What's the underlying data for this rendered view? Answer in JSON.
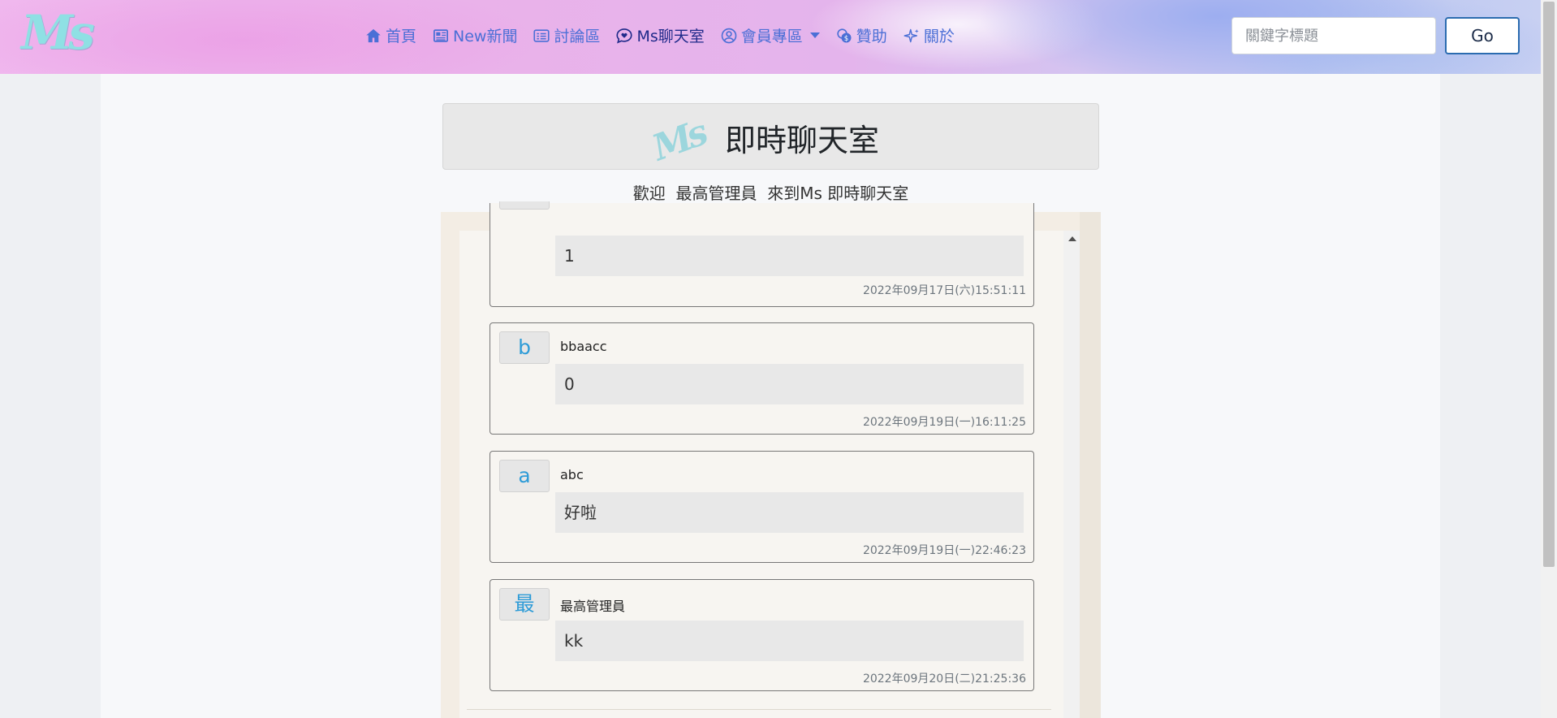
{
  "brand": {
    "logo_text": "Ms"
  },
  "nav": {
    "items": [
      {
        "label": "首頁",
        "icon": "home-icon"
      },
      {
        "label": "New新聞",
        "icon": "newspaper-icon"
      },
      {
        "label": "討論區",
        "icon": "card-list-icon"
      },
      {
        "label": "Ms聊天室",
        "icon": "chat-heart-icon",
        "active": true
      },
      {
        "label": "會員專區",
        "icon": "person-circle-icon",
        "dropdown": true
      },
      {
        "label": "贊助",
        "icon": "coins-icon"
      },
      {
        "label": "關於",
        "icon": "sparkle-icon"
      }
    ]
  },
  "search": {
    "placeholder": "關鍵字標題",
    "value": "",
    "button_label": "Go"
  },
  "header": {
    "title": "即時聊天室",
    "logo_text": "Ms"
  },
  "welcome": {
    "text": "歡迎  最高管理員  來到Ms 即時聊天室"
  },
  "messages": [
    {
      "avatar": "",
      "username": "",
      "body": "1",
      "timestamp": "2022年09月17日(六)15:51:11",
      "partial": true
    },
    {
      "avatar": "b",
      "username": "bbaacc",
      "body": "0",
      "timestamp": "2022年09月19日(一)16:11:25"
    },
    {
      "avatar": "a",
      "username": "abc",
      "body": "好啦",
      "timestamp": "2022年09月19日(一)22:46:23"
    },
    {
      "avatar": "最",
      "username": "最高管理員",
      "body": "kk",
      "timestamp": "2022年09月20日(二)21:25:36"
    }
  ],
  "colors": {
    "nav_link": "#4b6fd6",
    "nav_active": "#1f2a8a",
    "avatar_letter": "#2d9bd7",
    "go_border": "#2b6cb0"
  }
}
